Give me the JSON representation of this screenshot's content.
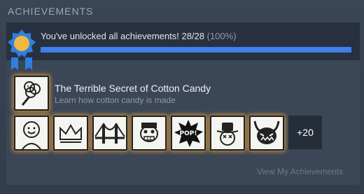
{
  "section": {
    "title": "ACHIEVEMENTS"
  },
  "progress": {
    "text": "You've unlocked all achievements! 28/28",
    "percent_text": "(100%)",
    "fraction": 1.0,
    "color": "#3f7fe8"
  },
  "recent": {
    "title": "The Terrible Secret of Cotton Candy",
    "description": "Learn how cotton candy is made",
    "icon": "cotton-candy-icon"
  },
  "achievements": [
    {
      "icon": "smiling-face-icon"
    },
    {
      "icon": "crown-icon"
    },
    {
      "icon": "bridge-icon"
    },
    {
      "icon": "grinning-skull-icon"
    },
    {
      "icon": "pop-burst-icon"
    },
    {
      "icon": "cowboy-hat-face-icon"
    },
    {
      "icon": "horned-monster-icon"
    }
  ],
  "more": {
    "label": "+20"
  },
  "link": {
    "label": "View My Achievements"
  },
  "colors": {
    "glow": "#e4a03c",
    "badge_blue": "#2f7fe0",
    "badge_gold": "#f0b840"
  }
}
